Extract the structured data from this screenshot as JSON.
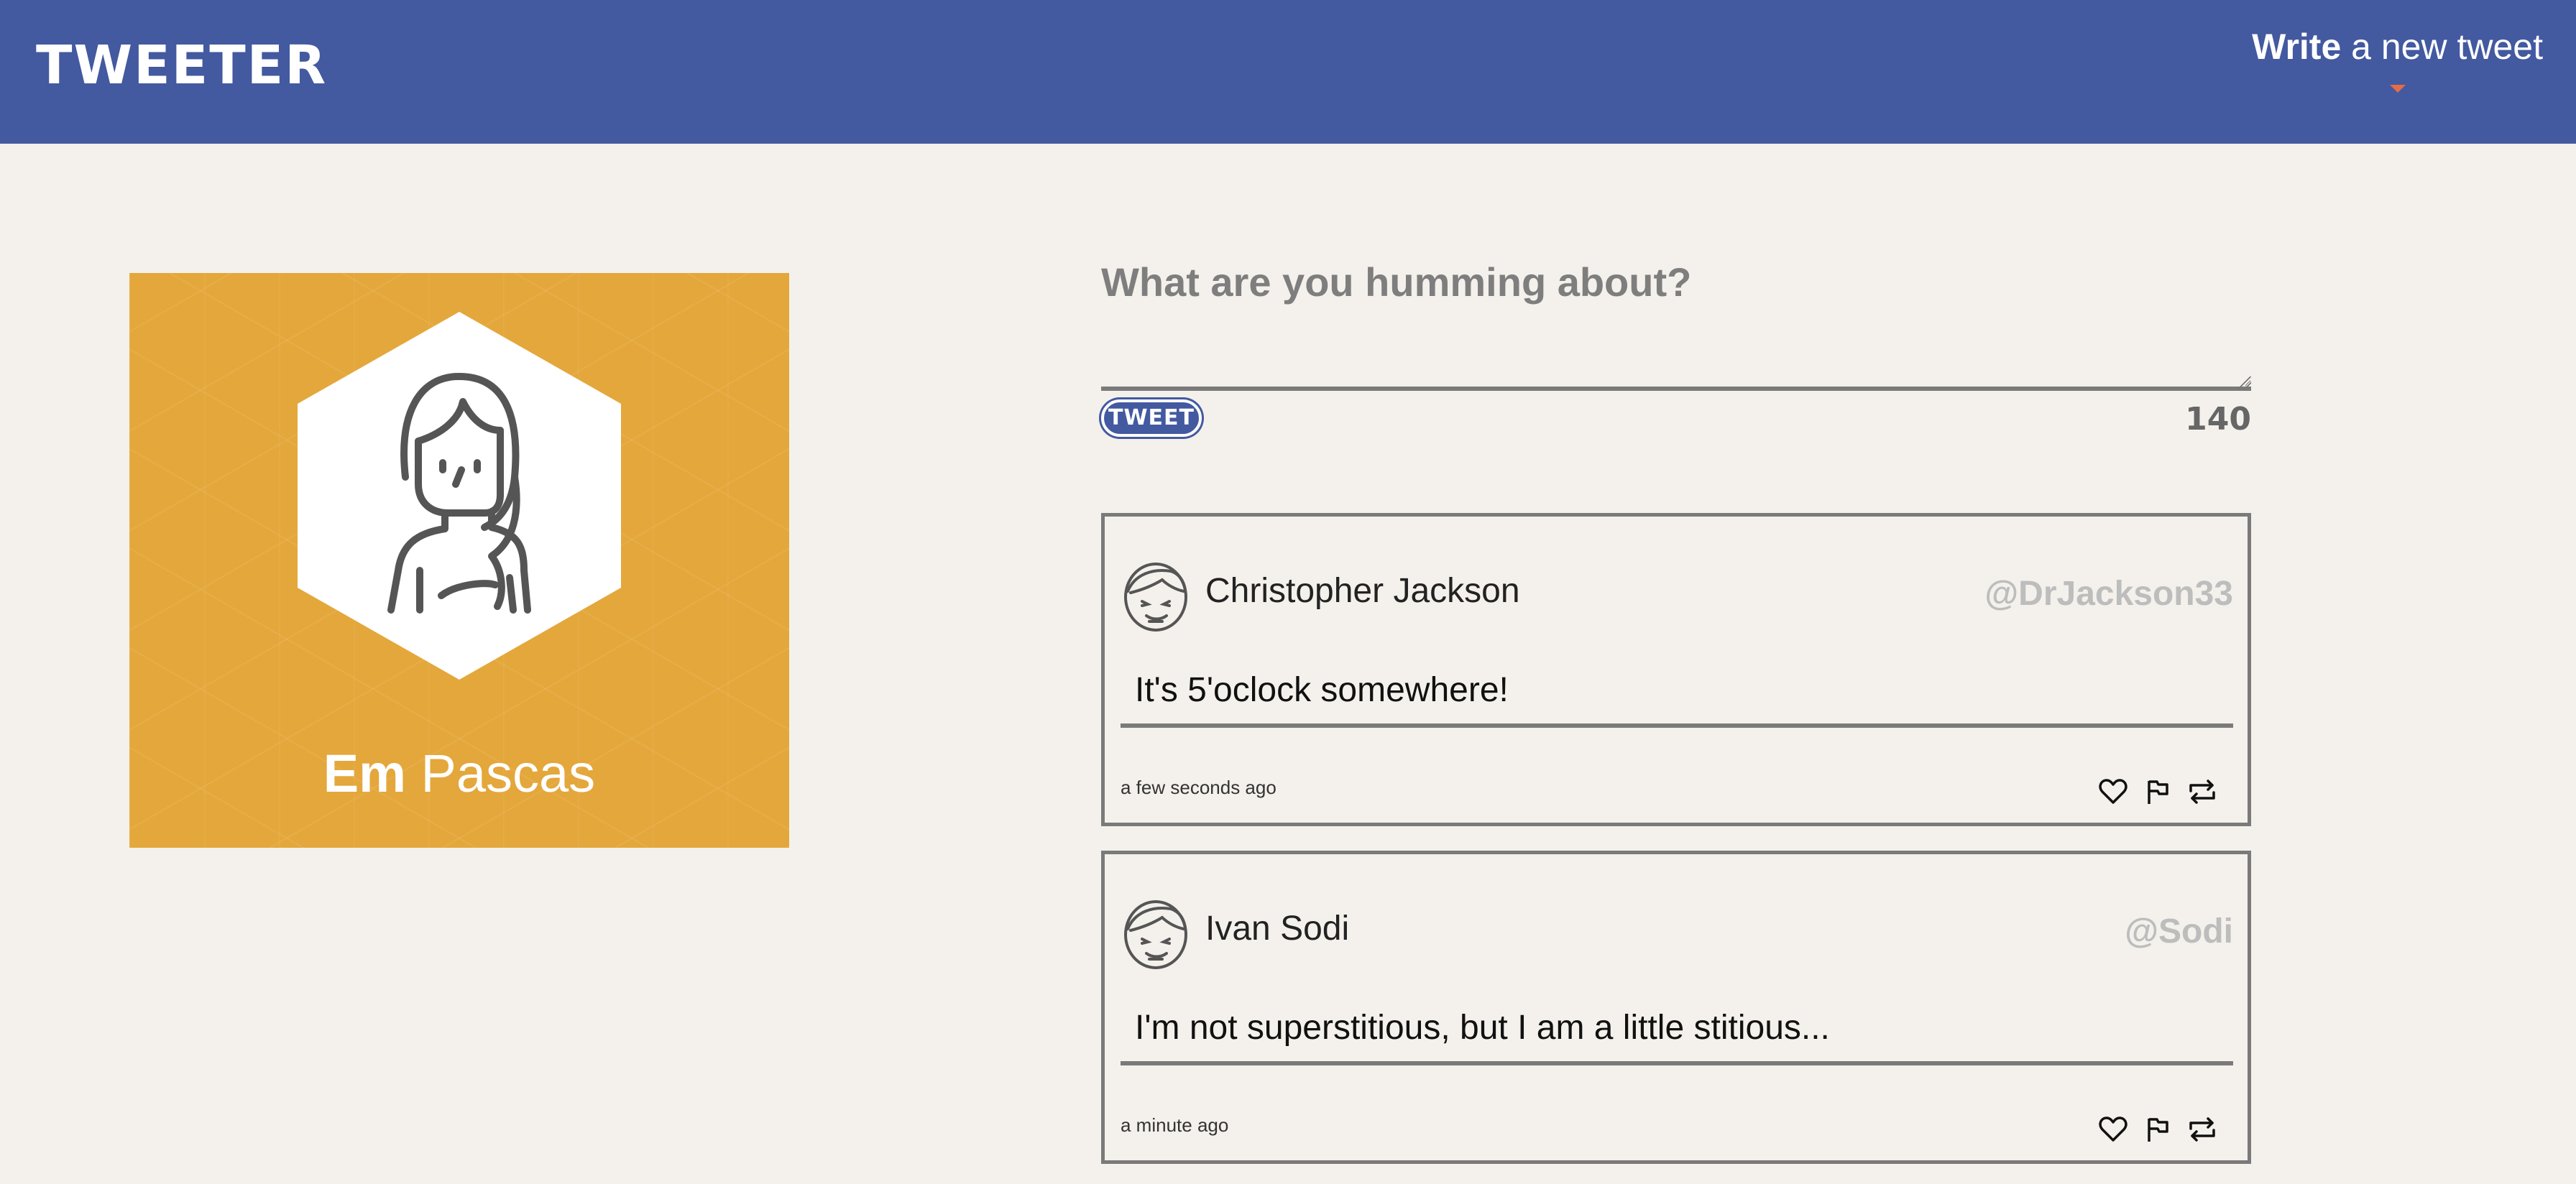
{
  "app": {
    "brand": "TWEETER"
  },
  "header": {
    "compose_toggle_strong": "Write",
    "compose_toggle_rest": " a new tweet"
  },
  "profile": {
    "first_name": "Em",
    "last_name": " Pascas",
    "avatar_icon": "woman-avatar-icon",
    "card_color": "#e4a73b"
  },
  "composer": {
    "placeholder": "What are you humming about?",
    "value": "",
    "submit_label": "TWEET",
    "char_count": "140"
  },
  "tweets": [
    {
      "name": "Christopher Jackson",
      "handle": "@DrJackson33",
      "text": "It's 5'oclock somewhere!",
      "time": "a few seconds ago",
      "avatar_icon": "man-avatar-icon",
      "actions": [
        "heart-icon",
        "flag-icon",
        "retweet-icon"
      ]
    },
    {
      "name": "Ivan Sodi",
      "handle": "@Sodi",
      "text": "I'm not superstitious, but I am a little stitious...",
      "time": "a minute ago",
      "avatar_icon": "man-avatar-icon",
      "actions": [
        "heart-icon",
        "flag-icon",
        "retweet-icon"
      ]
    }
  ],
  "colors": {
    "header": "#4359a0",
    "background": "#f4f1ec",
    "accent": "#e46d45",
    "handle": "#bdbdbd"
  }
}
